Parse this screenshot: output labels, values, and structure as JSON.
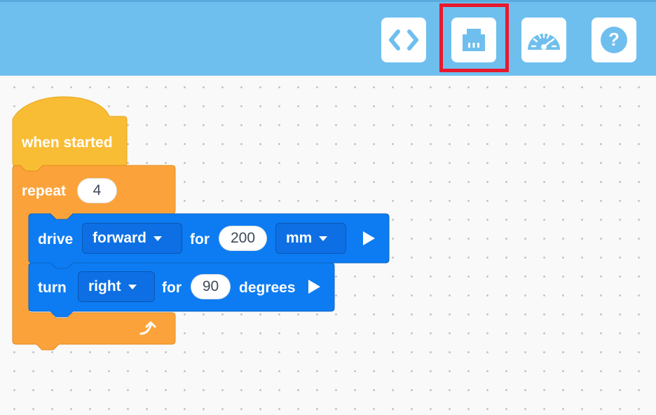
{
  "toolbar": {
    "buttons": [
      {
        "name": "code-view",
        "icon": "code-brackets-icon"
      },
      {
        "name": "devices",
        "icon": "device-port-icon",
        "highlighted": true
      },
      {
        "name": "dashboard",
        "icon": "speedometer-icon"
      },
      {
        "name": "help",
        "icon": "question-icon"
      }
    ],
    "highlight_color": "#e8192c",
    "background": "#6fbfee"
  },
  "blocks": {
    "event": {
      "label": "when started",
      "color": "#f9bd35"
    },
    "repeat": {
      "label": "repeat",
      "count": "4",
      "color": "#fba33a"
    },
    "drive": {
      "label": "drive",
      "direction": "forward",
      "for_label": "for",
      "distance": "200",
      "unit": "mm",
      "color": "#0d7cf2"
    },
    "turn": {
      "label": "turn",
      "direction": "right",
      "for_label": "for",
      "angle": "90",
      "unit_label": "degrees",
      "color": "#0d7cf2"
    }
  }
}
